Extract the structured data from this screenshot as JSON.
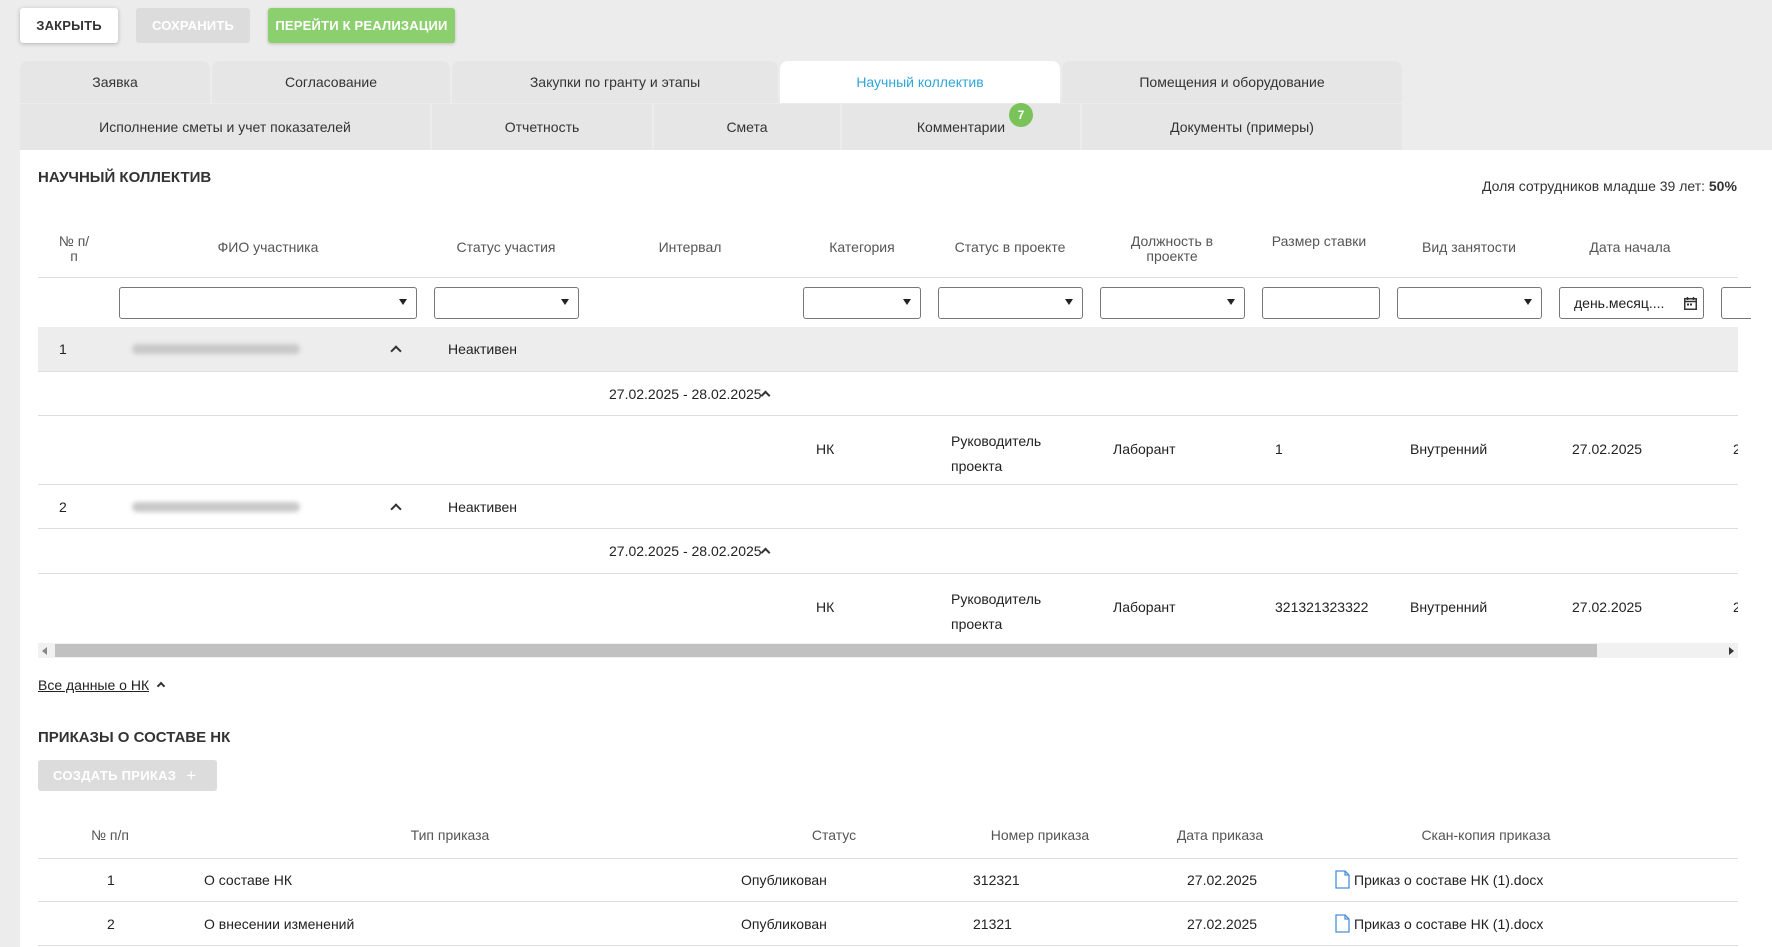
{
  "toolbar": {
    "close_label": "ЗАКРЫТЬ",
    "save_label": "СОХРАНИТЬ",
    "implement_label": "ПЕРЕЙТИ К РЕАЛИЗАЦИИ"
  },
  "tabs_row1": [
    "Заявка",
    "Согласование",
    "Закупки по гранту и этапы",
    "Научный коллектив",
    "Помещения и оборудование"
  ],
  "tabs_row2": [
    "Исполнение сметы и учет показателей",
    "Отчетность",
    "Смета",
    "Комментарии",
    "Документы (примеры)"
  ],
  "active_tab": "Научный коллектив",
  "comments_badge": "7",
  "team": {
    "title": "НАУЧНЫЙ КОЛЛЕКТИВ",
    "young_share_label": "Доля сотрудников младше 39 лет:",
    "young_share_value": "50%",
    "columns": [
      "№ п/п",
      "ФИО участника",
      "Статус участия",
      "Интервал",
      "Категория",
      "Статус в проекте",
      "Должность в проекте",
      "Размер ставки",
      "Вид занятости",
      "Дата начала"
    ],
    "filter_date_placeholder": "день.месяц....",
    "rows": [
      {
        "num": "1",
        "status": "Неактивен",
        "interval": "27.02.2025 - 28.02.2025",
        "category": "НК",
        "project_status_l1": "Руководитель",
        "project_status_l2": "проекта",
        "position": "Лаборант",
        "rate": "1",
        "employment": "Внутренний",
        "start_date": "27.02.2025"
      },
      {
        "num": "2",
        "status": "Неактивен",
        "interval": "27.02.2025 - 28.02.2025",
        "category": "НК",
        "project_status_l1": "Руководитель",
        "project_status_l2": "проекта",
        "position": "Лаборант",
        "rate": "321321323322",
        "employment": "Внутренний",
        "start_date": "27.02.2025"
      }
    ],
    "all_data_link": "Все данные о НК"
  },
  "orders": {
    "title": "ПРИКАЗЫ О СОСТАВЕ НК",
    "create_label": "СОЗДАТЬ ПРИКАЗ",
    "columns": [
      "№ п/п",
      "Тип приказа",
      "Статус",
      "Номер приказа",
      "Дата приказа",
      "Скан-копия приказа"
    ],
    "rows": [
      {
        "num": "1",
        "type": "О составе НК",
        "status": "Опубликован",
        "number": "312321",
        "date": "27.02.2025",
        "file": "Приказ о составе НК (1).docx"
      },
      {
        "num": "2",
        "type": "О внесении изменений",
        "status": "Опубликован",
        "number": "21321",
        "date": "27.02.2025",
        "file": "Приказ о составе НК (1).docx"
      }
    ]
  }
}
